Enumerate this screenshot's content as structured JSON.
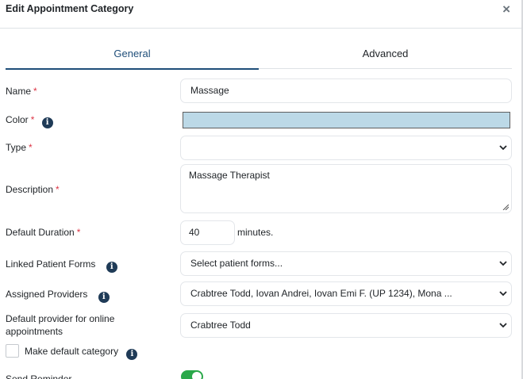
{
  "dialog": {
    "title": "Edit Appointment Category",
    "close_symbol": "×"
  },
  "tabs": [
    {
      "label": "General",
      "active": true
    },
    {
      "label": "Advanced",
      "active": false
    }
  ],
  "form": {
    "required_marker": "*",
    "name": {
      "label": "Name",
      "value": "Massage"
    },
    "color": {
      "label": "Color",
      "value_hex": "#bcd9e7"
    },
    "type": {
      "label": "Type",
      "value": ""
    },
    "description": {
      "label": "Description",
      "value": "Massage Therapist"
    },
    "default_duration": {
      "label": "Default Duration",
      "value": "40",
      "unit": "minutes."
    },
    "linked_patient_forms": {
      "label": "Linked Patient Forms",
      "placeholder": "Select patient forms..."
    },
    "assigned_providers": {
      "label": "Assigned Providers",
      "value": "Crabtree Todd, Iovan Andrei, Iovan Emi F. (UP 1234), Mona ..."
    },
    "default_provider_online": {
      "label_line1": "Default provider for online",
      "label_line2": "appointments",
      "value": "Crabtree Todd"
    },
    "make_default_category": {
      "label": "Make default category",
      "checked": false
    },
    "send_reminder": {
      "label": "Send Reminder",
      "enabled": true
    }
  },
  "icons": {
    "info": "info-icon",
    "chevron": "chevron-down-icon",
    "close": "close-icon"
  },
  "colors": {
    "primary": "#1f4e79",
    "required": "#dc3545",
    "toggle_on": "#2aa84a",
    "info_icon": "#1f3b57"
  }
}
